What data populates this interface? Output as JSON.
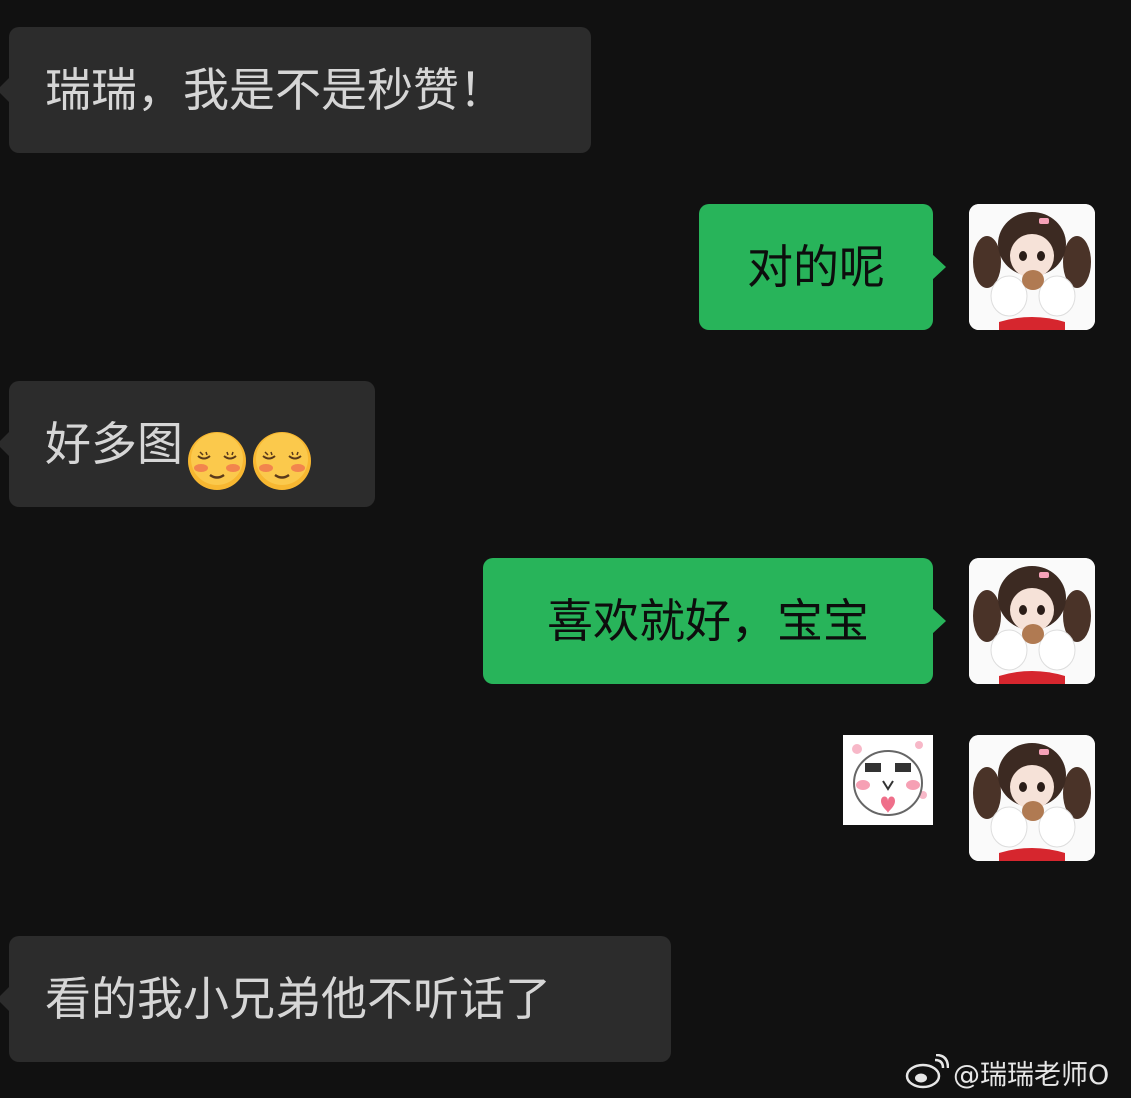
{
  "messages": [
    {
      "side": "received",
      "text": "瑞瑞，我是不是秒赞！"
    },
    {
      "side": "sent",
      "text": "对的呢"
    },
    {
      "side": "received",
      "text": "好多图",
      "emoji_count": 2,
      "emoji": "relieved-blushing-face"
    },
    {
      "side": "sent",
      "text": "喜欢就好，宝宝"
    },
    {
      "side": "sent",
      "sticker": "blushing-face-heart-sticker"
    },
    {
      "side": "received",
      "text": "看的我小兄弟他不听话了"
    }
  ],
  "colors": {
    "background": "#111111",
    "received_bubble": "#2c2c2c",
    "received_text": "#d6d6d6",
    "sent_bubble": "#28b45a",
    "sent_text": "#0d0d0d"
  },
  "watermark": {
    "icon": "weibo-logo-icon",
    "text": "@瑞瑞老师O"
  }
}
